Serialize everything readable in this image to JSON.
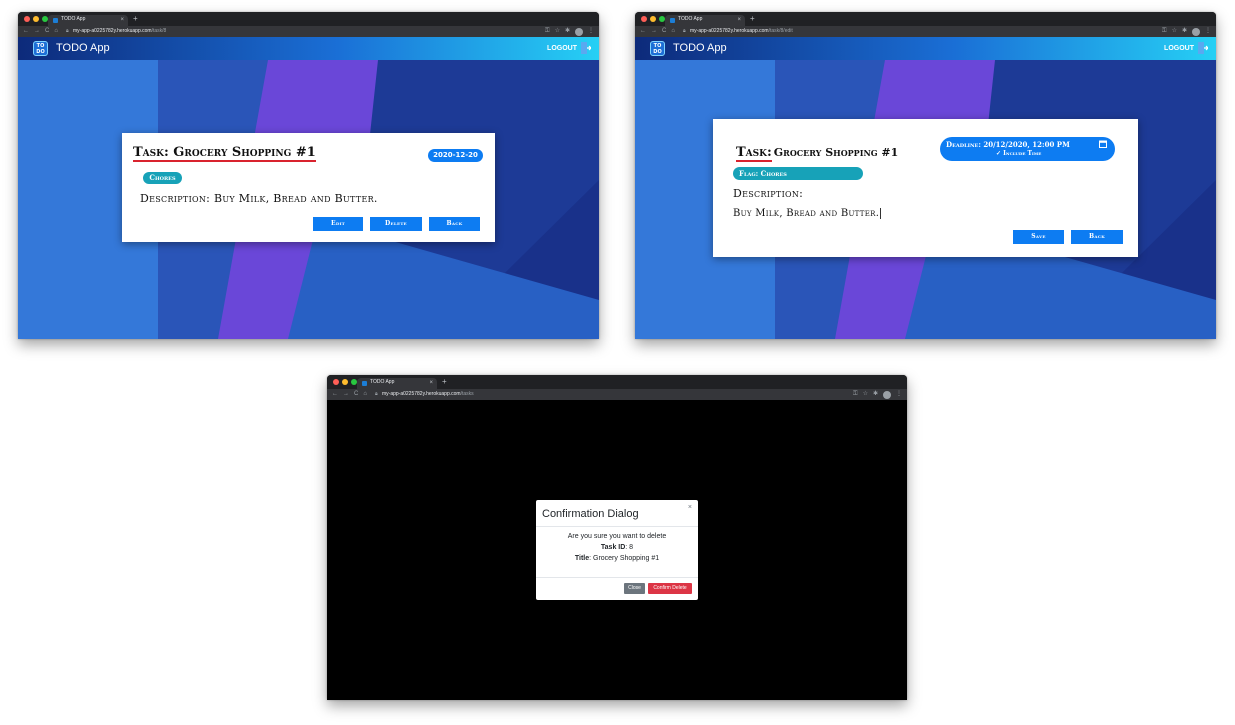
{
  "browser": {
    "tab_title": "TODO App",
    "tab_close": "×",
    "new_tab": "+",
    "url_host": "my-app-a0225782y.herokuapp.com",
    "screens": [
      {
        "path": "/task/8"
      },
      {
        "path": "/task/8/edit"
      },
      {
        "path": "/tasks"
      }
    ],
    "nav_icons": [
      "back-icon",
      "forward-icon",
      "reload-icon",
      "home-icon"
    ]
  },
  "app": {
    "logo_text_top": "TO",
    "logo_text_bottom": "DO",
    "brand": "TODO App",
    "logout_label": "LOGOUT"
  },
  "view_task": {
    "title": "Task: Grocery Shopping #1",
    "date_badge": "2020-12-20",
    "flag": "Chores",
    "description": "Description: Buy Milk, Bread and Butter.",
    "buttons": {
      "edit": "Edit",
      "delete": "Delete",
      "back": "Back"
    }
  },
  "edit_task": {
    "task_label": "Task:",
    "task_value": "Grocery Shopping #1",
    "deadline_label": "Deadline: 20/12/2020, 12:00 PM",
    "include_time": "✓ Include Time",
    "flag": "Flag: Chores",
    "description_label": "Description:",
    "description_value": "Buy Milk, Bread and Butter.",
    "buttons": {
      "save": "Save",
      "back": "Back"
    }
  },
  "dialog": {
    "title": "Confirmation Dialog",
    "close_x": "×",
    "prompt": "Are you sure you want to delete",
    "task_id_label": "Task ID",
    "task_id_value": ": 8",
    "title_label": "Title",
    "title_value": ": Grocery Shopping #1",
    "buttons": {
      "close": "Close",
      "confirm": "Confirm Delete"
    }
  },
  "colors": {
    "primary": "#0d7cf2",
    "info": "#17a2b8",
    "danger": "#dc3545",
    "secondary": "#6c757d",
    "underline": "#d9232e"
  }
}
